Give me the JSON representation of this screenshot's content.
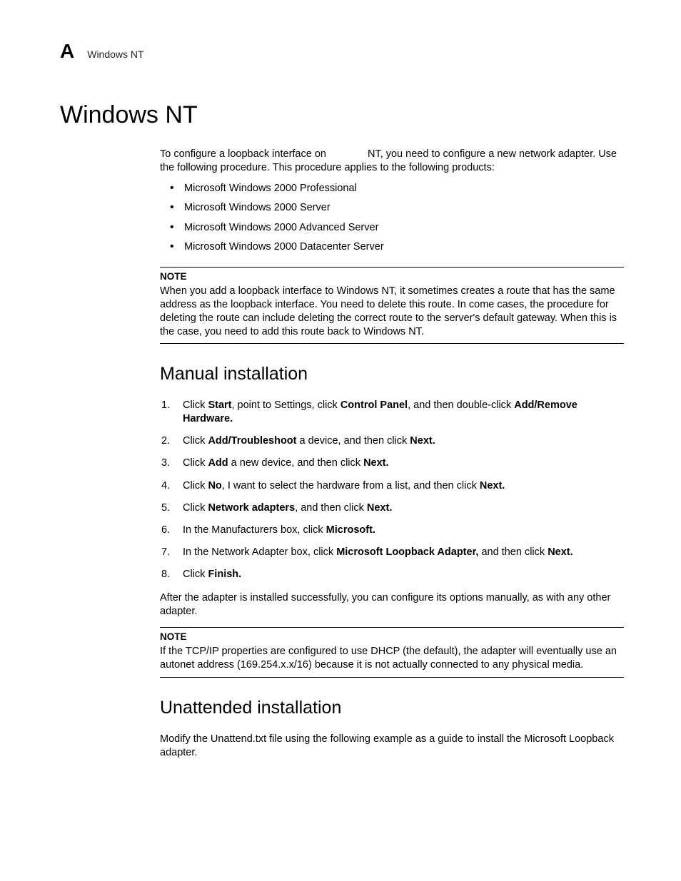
{
  "header": {
    "appendix_letter": "A",
    "running_title": "Windows NT"
  },
  "title": "Windows NT",
  "intro": {
    "pre": "To configure a loopback interface on",
    "post": "NT, you need to configure a new network adapter. Use the following procedure. This procedure applies to the following products:"
  },
  "products": [
    "Microsoft Windows 2000 Professional",
    "Microsoft Windows 2000 Server",
    "Microsoft Windows 2000 Advanced Server",
    "Microsoft Windows 2000 Datacenter Server"
  ],
  "note1": {
    "label": "NOTE",
    "text": "When you add a loopback interface to Windows NT, it sometimes creates a route that has the same address as the loopback interface. You need to delete this route. In come cases, the procedure for deleting the route can include deleting the correct route to the server's default gateway. When this is the case, you need to add this route back to Windows NT."
  },
  "manual": {
    "heading": "Manual installation",
    "steps": {
      "s1": {
        "a": "Click ",
        "b": "Start",
        "c": ", point to Settings, click ",
        "d": "Control Panel",
        "e": ", and then double-click ",
        "f": "Add/Remove Hardware."
      },
      "s2": {
        "a": "Click ",
        "b": "Add/Troubleshoot",
        "c": " a device, and then click ",
        "d": "Next."
      },
      "s3": {
        "a": "Click ",
        "b": "Add",
        "c": " a new device, and then click ",
        "d": "Next."
      },
      "s4": {
        "a": "Click ",
        "b": "No",
        "c": ", I want to select the hardware from a list, and then click ",
        "d": "Next."
      },
      "s5": {
        "a": "Click ",
        "b": "Network adapters",
        "c": ", and then click ",
        "d": "Next."
      },
      "s6": {
        "a": "In the Manufacturers box, click ",
        "b": "Microsoft."
      },
      "s7": {
        "a": "In the Network Adapter box, click ",
        "b": "Microsoft Loopback Adapter,",
        "c": " and then click ",
        "d": "Next."
      },
      "s8": {
        "a": "Click ",
        "b": "Finish."
      }
    },
    "after": "After the adapter is installed successfully, you can configure its options manually, as with any other adapter."
  },
  "note2": {
    "label": "NOTE",
    "text": "If the TCP/IP properties are configured to use DHCP (the default), the adapter will eventually use an autonet address (169.254.x.x/16) because it is not actually connected to any physical media."
  },
  "unattended": {
    "heading": "Unattended installation",
    "text": "Modify the Unattend.txt file using the following example as a guide to install the Microsoft Loopback adapter."
  }
}
